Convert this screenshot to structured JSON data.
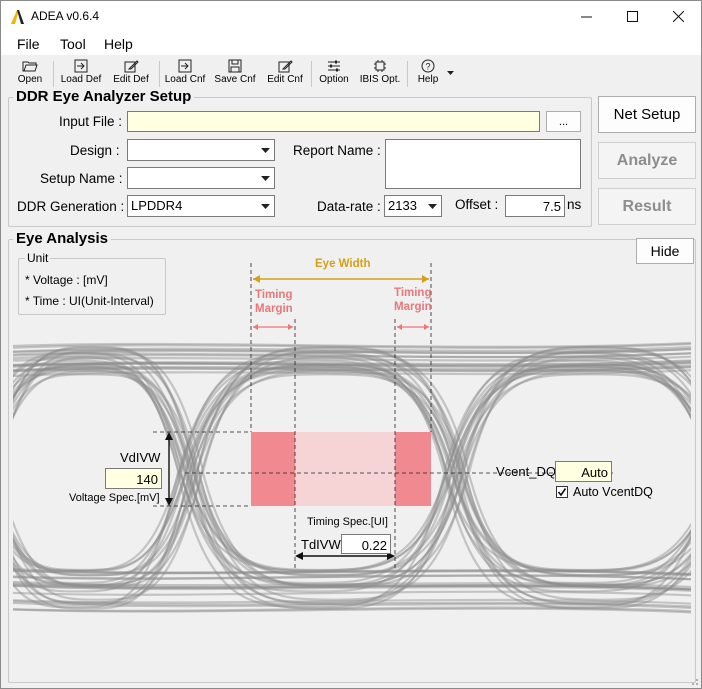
{
  "window": {
    "title": "ADEA v0.6.4",
    "minimize": "—",
    "maximize": "☐",
    "close": "✕"
  },
  "menu": [
    "File",
    "Tool",
    "Help"
  ],
  "toolbar": {
    "open": "Open",
    "load_def": "Load Def",
    "edit_def": "Edit Def",
    "load_cnf": "Load Cnf",
    "save_cnf": "Save Cnf",
    "edit_cnf": "Edit Cnf",
    "option": "Option",
    "ibis_opt": "IBIS Opt.",
    "help": "Help"
  },
  "setup": {
    "title": "DDR Eye Analyzer Setup",
    "input_file_label": "Input File :",
    "input_file_value": "",
    "browse_label": "...",
    "design_label": "Design :",
    "design_value": "",
    "setup_name_label": "Setup Name :",
    "setup_name_value": "",
    "ddr_generation_label": "DDR Generation :",
    "ddr_generation_value": "LPDDR4",
    "report_name_label": "Report Name :",
    "report_name_value": "",
    "data_rate_label": "Data-rate :",
    "data_rate_value": "2133",
    "offset_label": "Offset :",
    "offset_value": "7.5",
    "offset_unit": "ns"
  },
  "actions": {
    "net_setup": "Net Setup",
    "analyze": "Analyze",
    "result": "Result"
  },
  "eye": {
    "title": "Eye Analysis",
    "hide": "Hide",
    "unit_title": "Unit",
    "unit_voltage": "* Voltage : [mV]",
    "unit_time": "* Time : UI(Unit-Interval)",
    "eye_width": "Eye Width",
    "timing_margin_1": "Timing",
    "timing_margin_2": "Margin",
    "vdivw_label": "VdIVW",
    "vdivw_value": "140",
    "voltage_spec": "Voltage Spec.[mV]",
    "vcent_label": "Vcent_DQ",
    "vcent_value": "Auto",
    "auto_vcent_label": "Auto VcentDQ",
    "auto_vcent_checked": true,
    "timing_spec": "Timing Spec.[UI]",
    "tdivw_label": "TdIVW",
    "tdivw_value": "0.22",
    "colors": {
      "margin": "#f08a90",
      "mask": "#f5d3d5",
      "eye_width": "#d4a017",
      "timing_margin": "#e87878"
    }
  }
}
